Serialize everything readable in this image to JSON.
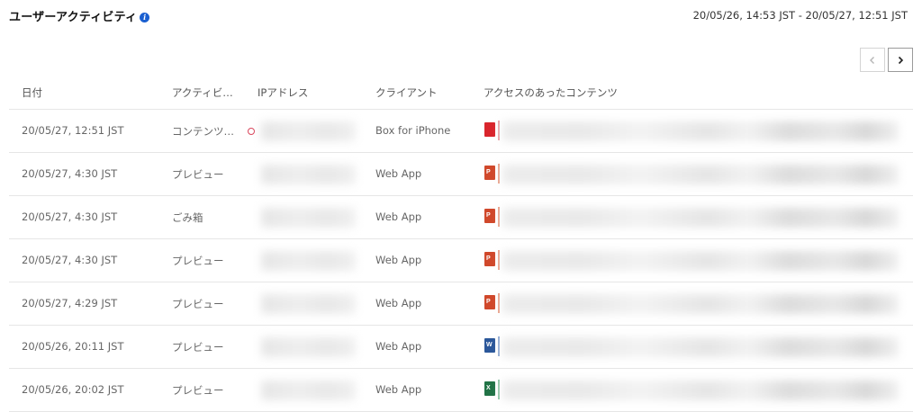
{
  "header": {
    "title": "ユーザーアクティビティ",
    "info_glyph": "i",
    "date_range": "20/05/26, 14:53 JST - 20/05/27, 12:51 JST"
  },
  "pager": {
    "prev_icon": "chevron-left-icon",
    "next_icon": "chevron-right-icon"
  },
  "table": {
    "columns": [
      "日付",
      "アクティビ…",
      "IPアドレス",
      "クライアント",
      "アクセスのあったコンテンツ"
    ],
    "rows": [
      {
        "date": "20/05/27, 12:51 JST",
        "activity": "コンテンツ…",
        "client": "Box for iPhone",
        "file_type": "pdf",
        "alert": true
      },
      {
        "date": "20/05/27, 4:30 JST",
        "activity": "プレビュー",
        "client": "Web App",
        "file_type": "powerpoint",
        "alert": false
      },
      {
        "date": "20/05/27, 4:30 JST",
        "activity": "ごみ箱",
        "client": "Web App",
        "file_type": "powerpoint",
        "alert": false
      },
      {
        "date": "20/05/27, 4:30 JST",
        "activity": "プレビュー",
        "client": "Web App",
        "file_type": "powerpoint",
        "alert": false
      },
      {
        "date": "20/05/27, 4:29 JST",
        "activity": "プレビュー",
        "client": "Web App",
        "file_type": "powerpoint",
        "alert": false
      },
      {
        "date": "20/05/26, 20:11 JST",
        "activity": "プレビュー",
        "client": "Web App",
        "file_type": "word",
        "alert": false
      },
      {
        "date": "20/05/26, 20:02 JST",
        "activity": "プレビュー",
        "client": "Web App",
        "file_type": "excel",
        "alert": false
      }
    ]
  },
  "file_types": {
    "pdf": {
      "icon": "pdf-file-icon",
      "color": "#d9252c",
      "accent": "#e8a0a4",
      "glyph": ""
    },
    "powerpoint": {
      "icon": "powerpoint-file-icon",
      "color": "#d0482b",
      "accent": "#e9a089",
      "glyph": "P"
    },
    "word": {
      "icon": "word-file-icon",
      "color": "#2b579a",
      "accent": "#8fa9d2",
      "glyph": "W"
    },
    "excel": {
      "icon": "excel-file-icon",
      "color": "#217346",
      "accent": "#8cc3a3",
      "glyph": "X"
    }
  },
  "colors": {
    "info": "#1a5fd0",
    "alert": "#d9455b",
    "divider": "#e6e6e6"
  }
}
